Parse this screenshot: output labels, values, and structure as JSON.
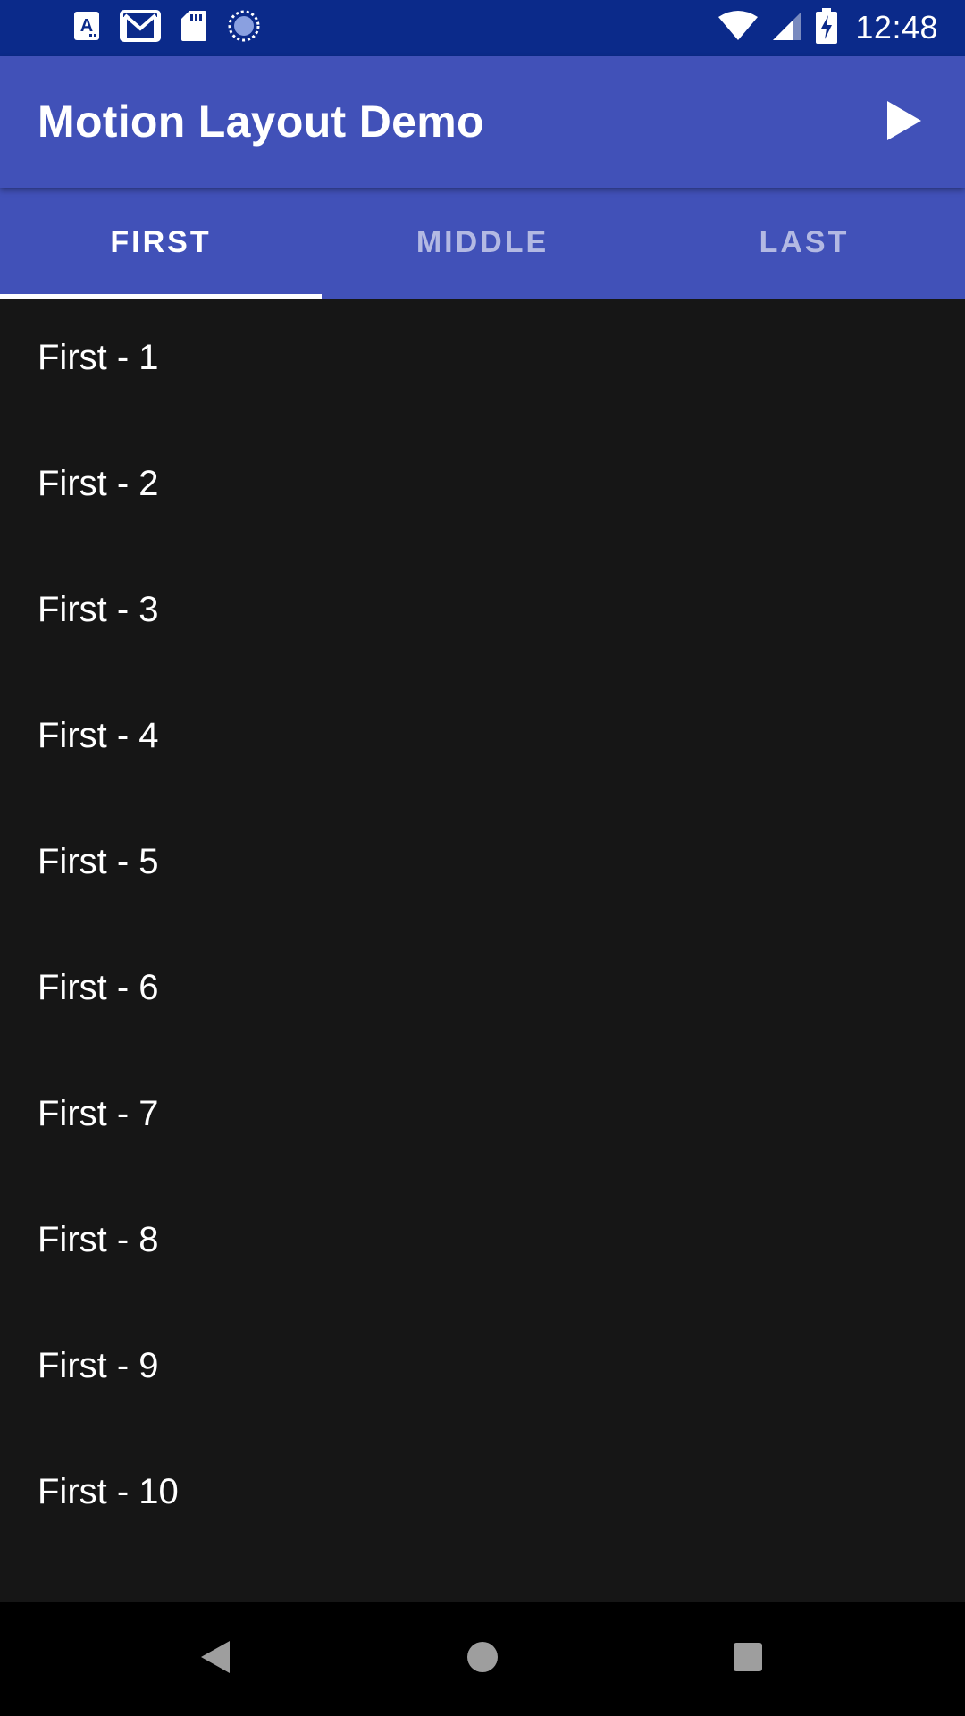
{
  "status_bar": {
    "time": "12:48",
    "left_icons": [
      "accessibility-a-icon",
      "gmail-icon",
      "sd-card-icon",
      "sync-circle-icon"
    ],
    "right_icons": [
      "wifi-icon",
      "signal-icon",
      "battery-charging-icon"
    ],
    "background": "#0b2a8a"
  },
  "app_bar": {
    "title": "Motion Layout Demo",
    "action_icon": "play-icon",
    "background": "#4151b8"
  },
  "tabs": [
    {
      "label": "FIRST",
      "active": true
    },
    {
      "label": "MIDDLE",
      "active": false
    },
    {
      "label": "LAST",
      "active": false
    }
  ],
  "list": {
    "items": [
      "First - 1",
      "First - 2",
      "First - 3",
      "First - 4",
      "First - 5",
      "First - 6",
      "First - 7",
      "First - 8",
      "First - 9",
      "First - 10"
    ],
    "background": "#161616"
  },
  "nav_bar": {
    "buttons": [
      "back-icon",
      "home-icon",
      "recents-icon"
    ]
  }
}
